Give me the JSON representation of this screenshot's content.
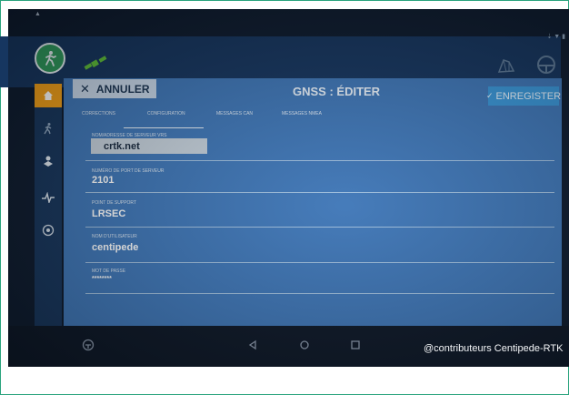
{
  "toolbar": {
    "cancel_label": "ANNULER",
    "title": "GNSS : ÉDITER",
    "save_label": "ENREGISTER"
  },
  "tabs": [
    {
      "label": "CORRECTIONS"
    },
    {
      "label": "CONFIGURATION",
      "active": true
    },
    {
      "label": "MESSAGES CAN"
    },
    {
      "label": "MESSAGES NMEA"
    }
  ],
  "fields": {
    "server": {
      "label": "NOM/ADRESSE DE SERVEUR VRS",
      "value": "crtk.net"
    },
    "port": {
      "label": "NUMÉRO DE PORT DE SERVEUR",
      "value": "2101"
    },
    "mountpoint": {
      "label": "POINT DE SUPPORT",
      "value": "LRSEC"
    },
    "username": {
      "label": "NOM D'UTILISATEUR",
      "value": "centipede"
    },
    "password": {
      "label": "MOT DE PASSE",
      "value": "********"
    }
  },
  "sidebar": {
    "items": [
      {
        "icon": "home-icon",
        "active": true
      },
      {
        "icon": "steering-icon"
      },
      {
        "icon": "implement-icon"
      },
      {
        "icon": "diagnostics-icon"
      },
      {
        "icon": "settings-icon"
      }
    ]
  },
  "header_icons": [
    "logo-icon",
    "satellite-icon",
    "field-map-icon",
    "steering-wheel-icon"
  ],
  "android_nav": [
    "back-icon",
    "home-icon",
    "recent-apps-icon"
  ],
  "watermark": "@contributeurs Centipede-RTK",
  "colors": {
    "topbar": "#163660",
    "panel": "#3f77b8",
    "active_nav": "#f2a019",
    "save_button": "#3a97d9",
    "logo": "#2f9a5e"
  }
}
